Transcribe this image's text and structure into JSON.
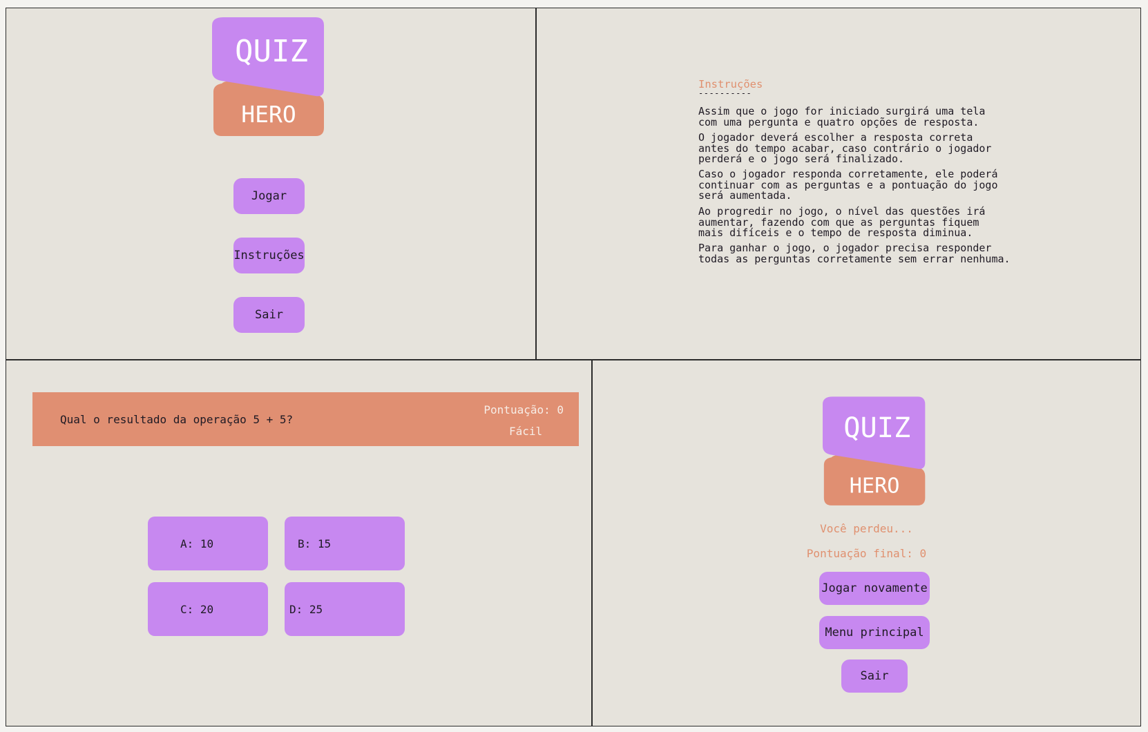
{
  "colors": {
    "purple": "#c788f0",
    "salmon": "#e08f72",
    "background": "#e6e3dc",
    "text_dark": "#1f1a24"
  },
  "logo": {
    "top_word": "QUIZ",
    "bottom_word": "HERO"
  },
  "main_menu": {
    "play_label": "Jogar",
    "instructions_label": "Instruções",
    "exit_label": "Sair"
  },
  "instructions": {
    "title": "Instruções",
    "divider": "----------",
    "paragraphs": [
      "Assim que o jogo for iniciado surgirá uma tela\ncom uma pergunta e quatro opções de resposta.",
      "O jogador deverá escolher a resposta correta\nantes do tempo acabar, caso contrário o jogador\nperderá e o jogo será finalizado.",
      "Caso o jogador responda corretamente, ele poderá\ncontinuar com as perguntas e a pontuação do jogo\nserá aumentada.",
      "Ao progredir no jogo, o nível das questões irá\naumentar, fazendo com que as perguntas fiquem\nmais difíceis e o tempo de resposta diminua.",
      "Para ganhar o jogo, o jogador precisa responder\ntodas as perguntas corretamente sem errar nenhuma."
    ]
  },
  "game": {
    "question": "Qual o resultado da operação 5 + 5?",
    "score_label": "Pontuação: 0",
    "level_label": "Fácil",
    "answers": [
      "A: 10",
      "B: 15",
      "C: 20",
      "D: 25"
    ]
  },
  "game_over": {
    "lost_message": "Você perdeu...",
    "final_score": "Pontuação final: 0",
    "play_again_label": "Jogar novamente",
    "main_menu_label": "Menu principal",
    "exit_label": "Sair"
  }
}
